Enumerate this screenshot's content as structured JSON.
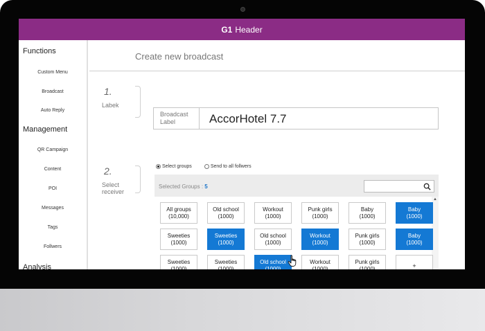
{
  "header": {
    "brand": "G1",
    "title": "Header"
  },
  "sidebar": {
    "groups": [
      {
        "label": "Functions",
        "items": [
          "Custom Menu",
          "Broadcast",
          "Auto Reply"
        ]
      },
      {
        "label": "Management",
        "items": [
          "QR Campaign",
          "Content",
          "POI",
          "Messages",
          "Tags",
          "Follwers"
        ]
      },
      {
        "label": "Analysis",
        "items": []
      }
    ]
  },
  "main": {
    "title": "Create new broadcast",
    "step1": {
      "number": "1.",
      "label": "Labek"
    },
    "step2": {
      "number": "2.",
      "label_line1": "Select",
      "label_line2": "receiver"
    },
    "broadcast_label": {
      "key_line1": "Broadcast",
      "key_line2": "Label",
      "value": "AccorHotel 7.7"
    },
    "radios": {
      "select_groups": "Select groups",
      "send_all": "Send to all follwers",
      "selected": "select_groups"
    },
    "selected_groups": {
      "label": "Selected Groups : ",
      "count": "5"
    },
    "search": {
      "value": ""
    },
    "tiles": [
      [
        {
          "name": "All groups",
          "count": "(10,000)",
          "sel": false
        },
        {
          "name": "Old school",
          "count": "(1000)",
          "sel": false
        },
        {
          "name": "Workout",
          "count": "(1000)",
          "sel": false
        },
        {
          "name": "Punk girls",
          "count": "(1000)",
          "sel": false
        },
        {
          "name": "Baby",
          "count": "(1000)",
          "sel": false
        },
        {
          "name": "Baby",
          "count": "(1000)",
          "sel": true
        }
      ],
      [
        {
          "name": "Sweeties",
          "count": "(1000)",
          "sel": false
        },
        {
          "name": "Sweeties",
          "count": "(1000)",
          "sel": true
        },
        {
          "name": "Old school",
          "count": "(1000)",
          "sel": false
        },
        {
          "name": "Workout",
          "count": "(1000)",
          "sel": true
        },
        {
          "name": "Punk girls",
          "count": "(1000)",
          "sel": false
        },
        {
          "name": "Baby",
          "count": "(1000)",
          "sel": true
        }
      ],
      [
        {
          "name": "Sweeties",
          "count": "(1000)",
          "sel": false
        },
        {
          "name": "Sweeties",
          "count": "(1000)",
          "sel": false
        },
        {
          "name": "Old school",
          "count": "(1000)",
          "sel": true
        },
        {
          "name": "Workout",
          "count": "(1000)",
          "sel": false
        },
        {
          "name": "Punk girls",
          "count": "(1000)",
          "sel": false
        },
        {
          "name": "+",
          "count": "",
          "sel": false
        }
      ]
    ]
  },
  "colors": {
    "header": "#8b2c85",
    "selected_tile": "#1479d4",
    "accent_count": "#1a73c8"
  }
}
